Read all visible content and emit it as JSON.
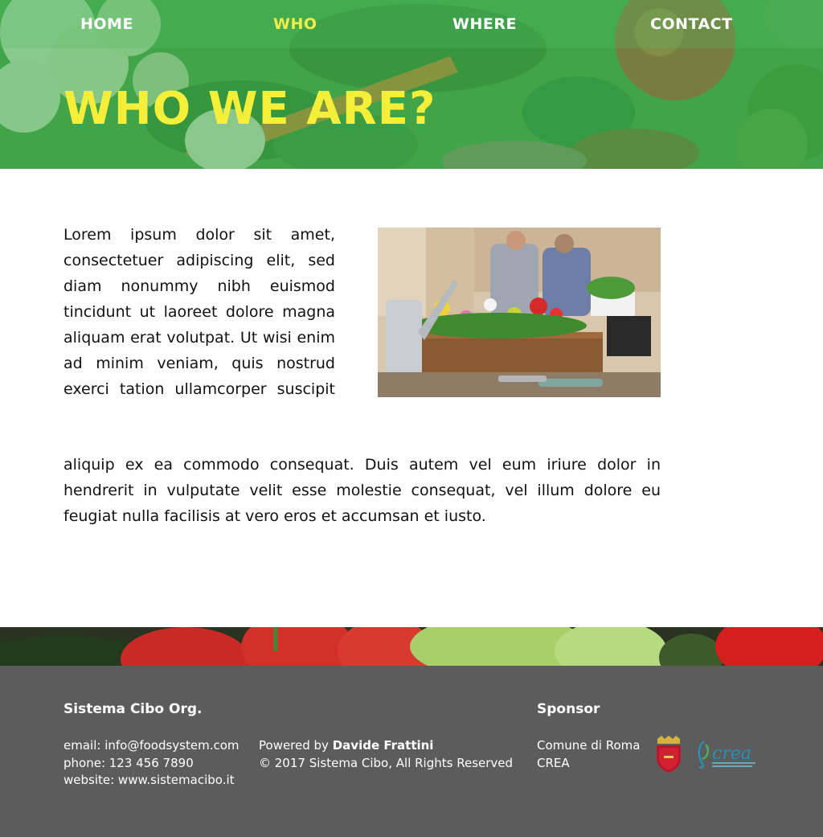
{
  "nav": {
    "items": [
      {
        "label": "HOME",
        "active": false
      },
      {
        "label": "WHO",
        "active": true
      },
      {
        "label": "WHERE",
        "active": false
      },
      {
        "label": "CONTACT",
        "active": false
      }
    ]
  },
  "hero": {
    "title": "WHO WE ARE?"
  },
  "content": {
    "paragraph_1": "Lorem ipsum dolor sit amet, consectetuer adipiscing elit, sed diam nonummy nibh euismod tincidunt ut laoreet dolore magna aliquam erat volutpat. Ut wisi enim ad minim veniam, quis nostrud exerci tation ullamcorper suscipit lobortis nisl ut",
    "paragraph_2": "aliquip ex ea commodo consequat. Duis autem vel eum iriure dolor in hendrerit in vulputate velit esse molestie consequat, vel illum dolore eu feugiat nulla facilisis at vero eros et accumsan et iusto."
  },
  "footer": {
    "org": {
      "heading": "Sistema Cibo Org.",
      "email": "email: info@foodsystem.com",
      "phone": "phone: 123 456 7890",
      "website": "website: www.sistemacibo.it"
    },
    "credits": {
      "powered_prefix": "Powered by ",
      "powered_name": "Davide Frattini",
      "copyright": "© 2017 Sistema Cibo, All Rights Reserved"
    },
    "sponsor": {
      "heading": "Sponsor",
      "line_1": "Comune di Roma",
      "line_2": "CREA",
      "crea_logo_text": "crea"
    }
  },
  "colors": {
    "accent_yellow": "#f5ef3a",
    "hero_green": "#3f9d4a",
    "footer_gray": "#5c5c5c",
    "roma_red": "#c0182a",
    "crea_teal": "#2a8fb0"
  }
}
